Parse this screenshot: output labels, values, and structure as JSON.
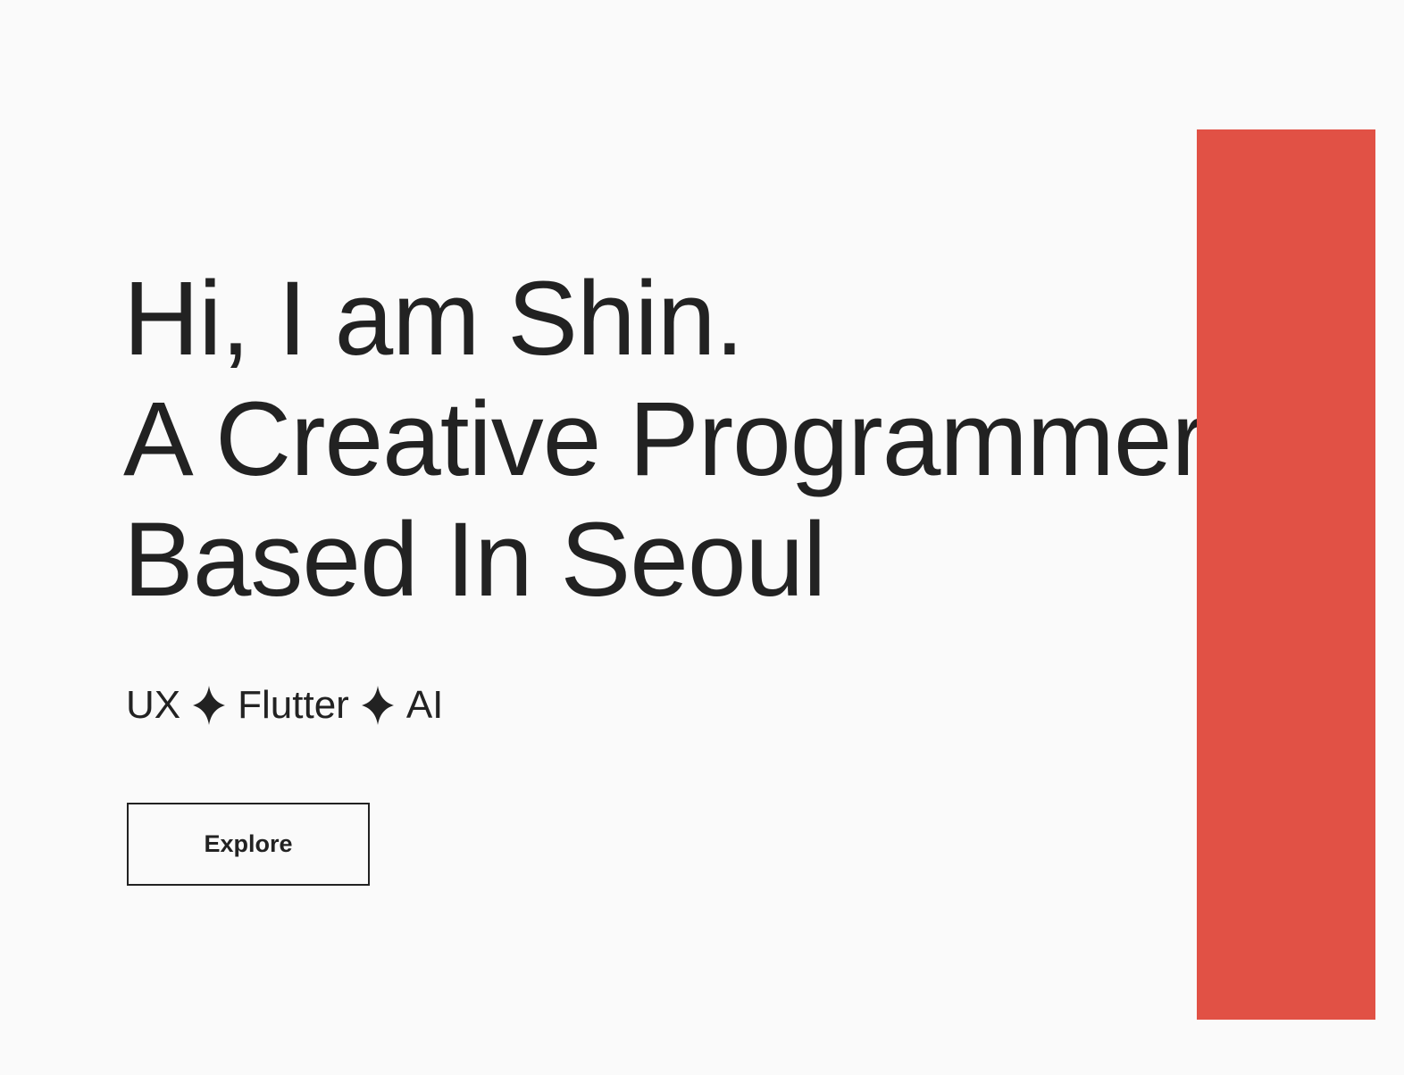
{
  "hero": {
    "lines": [
      "Hi, I am Shin.",
      "A Creative Programmer",
      "Based In Seoul"
    ]
  },
  "skills": {
    "items": [
      "UX",
      "Flutter",
      "AI"
    ],
    "separator_icon": "four-point-star-icon"
  },
  "cta": {
    "label": "Explore"
  },
  "colors": {
    "background": "#fafafa",
    "text": "#222222",
    "accent": "#e15145"
  }
}
